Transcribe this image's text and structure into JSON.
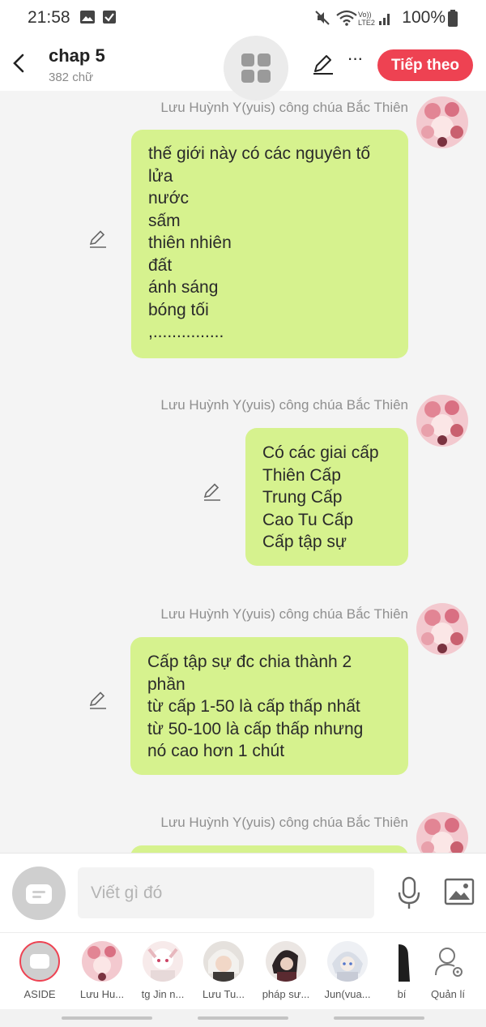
{
  "status": {
    "time": "21:58",
    "battery": "100%"
  },
  "header": {
    "title": "chap 5",
    "word_count": "382 chữ",
    "next_label": "Tiếp theo"
  },
  "messages": [
    {
      "author": "Lưu Huỳnh Y(yuis) công chúa Bắc Thiên",
      "text": "thế giới này có các nguyên tố\nlửa\nnước\nsấm\nthiên nhiên\nđất\nánh sáng\nbóng tối\n,..............."
    },
    {
      "author": "Lưu Huỳnh Y(yuis) công chúa Bắc Thiên",
      "text": "Có các giai cấp\nThiên Cấp\nTrung Cấp\nCao Tu  Cấp\nCấp tập sự"
    },
    {
      "author": "Lưu Huỳnh Y(yuis) công chúa Bắc Thiên",
      "text": "Cấp tập sự đc chia thành 2\nphần\ntừ cấp 1-50 là cấp thấp nhất\ntừ 50-100 là cấp thấp nhưng\nnó cao hơn 1 chút"
    },
    {
      "author": "Lưu Huỳnh Y(yuis) công chúa Bắc Thiên",
      "text": ""
    }
  ],
  "input": {
    "placeholder": "Viết gì đó"
  },
  "characters": [
    {
      "label": "ASIDE"
    },
    {
      "label": "Lưu Hu..."
    },
    {
      "label": "tg Jin n..."
    },
    {
      "label": "Lưu Tu..."
    },
    {
      "label": "pháp sư..."
    },
    {
      "label": "Jun(vua..."
    },
    {
      "label": "bí"
    },
    {
      "label": "Quản lí"
    }
  ],
  "colors": {
    "accent": "#ee4252",
    "bubble": "#d6f28e"
  }
}
